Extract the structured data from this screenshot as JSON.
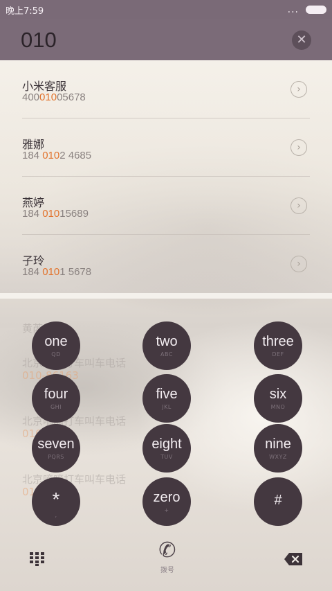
{
  "status": {
    "time": "晚上7:59",
    "dots": "...",
    "battery": "battery-icon"
  },
  "search": {
    "query": "010",
    "clear_icon": "✕"
  },
  "results": [
    {
      "name": "小米客服",
      "pre": "400",
      "hl": "010",
      "post": "05678"
    },
    {
      "name": "雅娜",
      "pre": "184 ",
      "hl": "010",
      "post": "2 4685"
    },
    {
      "name": "燕婷",
      "pre": "184 ",
      "hl": "010",
      "post": "15689"
    },
    {
      "name": "子玲",
      "pre": "184 ",
      "hl": "010",
      "post": "1 5678"
    }
  ],
  "ghost": {
    "name1": "黄芮",
    "line1": "北京嘀嘀打车叫车电话",
    "num1": "010-86163",
    "line2": "北京嘀嘀打车叫车电话",
    "num2": "010",
    "line3": "北京嘀嘀打车叫车电话",
    "num3": "01"
  },
  "keypad": [
    {
      "main": "one",
      "sub": "QD"
    },
    {
      "main": "two",
      "sub": "ABC"
    },
    {
      "main": "three",
      "sub": "DEF"
    },
    {
      "main": "four",
      "sub": "GHI"
    },
    {
      "main": "five",
      "sub": "JKL"
    },
    {
      "main": "six",
      "sub": "MNO"
    },
    {
      "main": "seven",
      "sub": "PQRS"
    },
    {
      "main": "eight",
      "sub": "TUV"
    },
    {
      "main": "nine",
      "sub": "WXYZ"
    },
    {
      "main": "*",
      "sub": ","
    },
    {
      "main": "zero",
      "sub": "+"
    },
    {
      "main": "#",
      "sub": ""
    }
  ],
  "bottom": {
    "call_label": "拨号",
    "phone_glyph": "✆"
  },
  "colors": {
    "header": "#7b6b78",
    "key": "#443840",
    "highlight": "#e2742e"
  }
}
